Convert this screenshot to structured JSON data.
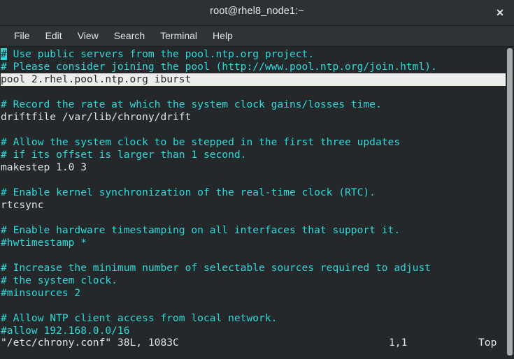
{
  "window": {
    "title": "root@rhel8_node1:~",
    "close_label": "✕"
  },
  "menubar": {
    "items": [
      {
        "label": "File",
        "name": "menu-item-file"
      },
      {
        "label": "Edit",
        "name": "menu-item-edit"
      },
      {
        "label": "View",
        "name": "menu-item-view"
      },
      {
        "label": "Search",
        "name": "menu-item-search"
      },
      {
        "label": "Terminal",
        "name": "menu-item-terminal"
      },
      {
        "label": "Help",
        "name": "menu-item-help"
      }
    ]
  },
  "terminal": {
    "editor": "vim",
    "cursor_char": "#",
    "lines": [
      {
        "text": "# Use public servers from the pool.ntp.org project.",
        "kind": "comment",
        "cursor": true
      },
      {
        "text": "# Please consider joining the pool (http://www.pool.ntp.org/join.html).",
        "kind": "comment"
      },
      {
        "text": "pool 2.rhel.pool.ntp.org iburst",
        "kind": "code",
        "highlight": true
      },
      {
        "text": "",
        "kind": "blank"
      },
      {
        "text": "# Record the rate at which the system clock gains/losses time.",
        "kind": "comment"
      },
      {
        "text": "driftfile /var/lib/chrony/drift",
        "kind": "code"
      },
      {
        "text": "",
        "kind": "blank"
      },
      {
        "text": "# Allow the system clock to be stepped in the first three updates",
        "kind": "comment"
      },
      {
        "text": "# if its offset is larger than 1 second.",
        "kind": "comment"
      },
      {
        "text": "makestep 1.0 3",
        "kind": "code"
      },
      {
        "text": "",
        "kind": "blank"
      },
      {
        "text": "# Enable kernel synchronization of the real-time clock (RTC).",
        "kind": "comment"
      },
      {
        "text": "rtcsync",
        "kind": "code"
      },
      {
        "text": "",
        "kind": "blank"
      },
      {
        "text": "# Enable hardware timestamping on all interfaces that support it.",
        "kind": "comment"
      },
      {
        "text": "#hwtimestamp *",
        "kind": "comment"
      },
      {
        "text": "",
        "kind": "blank"
      },
      {
        "text": "# Increase the minimum number of selectable sources required to adjust",
        "kind": "comment"
      },
      {
        "text": "# the system clock.",
        "kind": "comment"
      },
      {
        "text": "#minsources 2",
        "kind": "comment"
      },
      {
        "text": "",
        "kind": "blank"
      },
      {
        "text": "# Allow NTP client access from local network.",
        "kind": "comment"
      },
      {
        "text": "#allow 192.168.0.0/16",
        "kind": "comment"
      }
    ]
  },
  "statusline": {
    "file": "\"/etc/chrony.conf\" 38L, 1083C",
    "position": "1,1",
    "scroll": "Top"
  },
  "colors": {
    "background": "#24282a",
    "titlebar": "#2c3134",
    "menubar": "#2e3336",
    "comment": "#2fd9d9",
    "code": "#e0e4e5",
    "highlight_bg": "#ececea",
    "cursor": "#2fd9d9",
    "scrollbar_thumb": "#a8abac"
  }
}
